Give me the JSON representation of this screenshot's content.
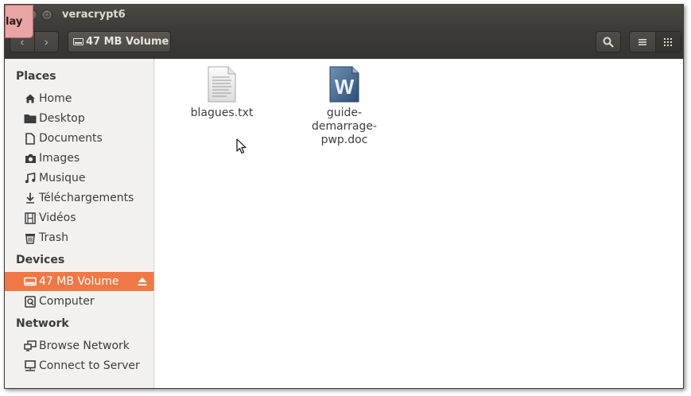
{
  "window": {
    "title": "veracrypt6",
    "overlay_label": "lay"
  },
  "toolbar": {
    "back": "‹",
    "forward": "›",
    "location": "47 MB Volume"
  },
  "sidebar": {
    "places_heading": "Places",
    "places": [
      {
        "label": "Home",
        "icon": "home-icon"
      },
      {
        "label": "Desktop",
        "icon": "folder-icon"
      },
      {
        "label": "Documents",
        "icon": "document-icon"
      },
      {
        "label": "Images",
        "icon": "camera-icon"
      },
      {
        "label": "Musique",
        "icon": "music-icon"
      },
      {
        "label": "Téléchargements",
        "icon": "download-icon"
      },
      {
        "label": "Vidéos",
        "icon": "film-icon"
      },
      {
        "label": "Trash",
        "icon": "trash-icon"
      }
    ],
    "devices_heading": "Devices",
    "devices": [
      {
        "label": "47 MB Volume",
        "icon": "drive-icon",
        "selected": true
      },
      {
        "label": "Computer",
        "icon": "computer-icon"
      }
    ],
    "network_heading": "Network",
    "network": [
      {
        "label": "Browse Network",
        "icon": "network-icon"
      },
      {
        "label": "Connect to Server",
        "icon": "server-icon"
      }
    ]
  },
  "files": [
    {
      "name_line1": "blagues.txt",
      "name_line2": "",
      "icon": "text-file-icon"
    },
    {
      "name_line1": "guide-demarrage-",
      "name_line2": "pwp.doc",
      "icon": "word-document-icon"
    }
  ],
  "colors": {
    "accent": "#f07746",
    "header_dark": "#3c3b37",
    "sidebar_bg": "#f2f1f0"
  }
}
